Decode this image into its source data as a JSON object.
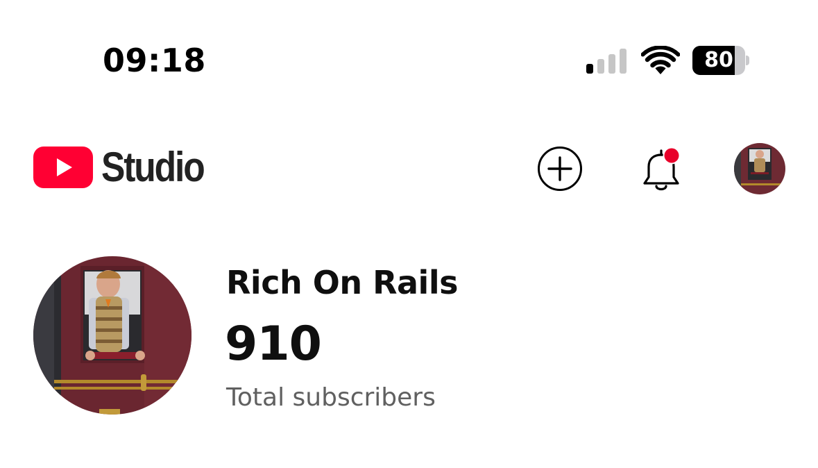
{
  "status_bar": {
    "time": "09:18",
    "battery": "80",
    "battery_level": 0.8,
    "signal_bars_active": 1,
    "signal_bars_total": 4,
    "icons": [
      "cellular-signal-icon",
      "wifi-icon",
      "battery-icon"
    ]
  },
  "header": {
    "logo_text": "Studio",
    "icons": [
      "youtube-play-icon",
      "create-plus-icon",
      "notification-bell-icon",
      "profile-avatar"
    ],
    "has_notification_dot": true
  },
  "channel": {
    "name": "Rich On Rails",
    "subscriber_count": "910",
    "subscriber_label": "Total subscribers"
  },
  "colors": {
    "brand_red": "#ff0033",
    "notification_dot": "#e8002a",
    "text_primary": "#0f0f0f",
    "text_secondary": "#606060",
    "avatar_maroon": "#6e2a33"
  }
}
